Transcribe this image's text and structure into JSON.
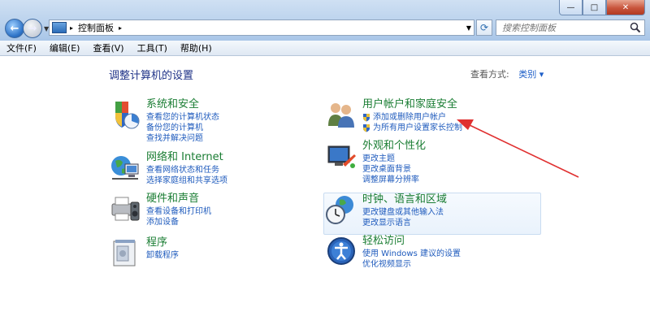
{
  "window": {
    "minimize": "—",
    "maximize": "□",
    "close": "✕"
  },
  "address": {
    "crumb": "控制面板",
    "search_placeholder": "搜索控制面板"
  },
  "menu": [
    "文件(F)",
    "编辑(E)",
    "查看(V)",
    "工具(T)",
    "帮助(H)"
  ],
  "page": {
    "heading": "调整计算机的设置",
    "view_by_label": "查看方式:",
    "view_by_value": "类别 ▾"
  },
  "categories": [
    {
      "title": "系统和安全",
      "links": [
        "查看您的计算机状态",
        "备份您的计算机",
        "查找并解决问题"
      ]
    },
    {
      "title": "网络和 Internet",
      "links": [
        "查看网络状态和任务",
        "选择家庭组和共享选项"
      ]
    },
    {
      "title": "硬件和声音",
      "links": [
        "查看设备和打印机",
        "添加设备"
      ]
    },
    {
      "title": "程序",
      "links": [
        "卸载程序"
      ]
    },
    {
      "title": "用户帐户和家庭安全",
      "links": [
        "添加或删除用户帐户",
        "为所有用户设置家长控制"
      ]
    },
    {
      "title": "外观和个性化",
      "links": [
        "更改主题",
        "更改桌面背景",
        "调整屏幕分辨率"
      ]
    },
    {
      "title": "时钟、语言和区域",
      "links": [
        "更改键盘或其他输入法",
        "更改显示语言"
      ]
    },
    {
      "title": "轻松访问",
      "links": [
        "使用 Windows 建议的设置",
        "优化视频显示"
      ]
    }
  ],
  "colors": {
    "category_title": "#1a7d33",
    "link": "#1f5bbd",
    "heading": "#1e3287",
    "annotation_arrow": "#e03030"
  }
}
